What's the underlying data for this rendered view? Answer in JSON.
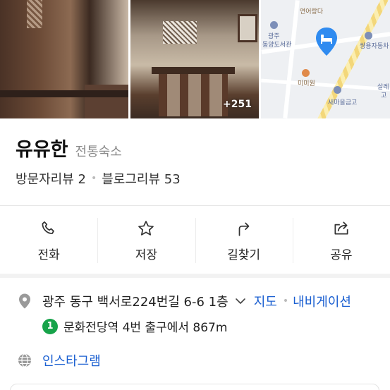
{
  "photos": {
    "more_count": "+251"
  },
  "map": {
    "pois": [
      {
        "label": "연어랑다",
        "type": "food"
      },
      {
        "label": "광주",
        "type": "place"
      },
      {
        "label": "동양도서관",
        "type": "place"
      },
      {
        "label": "쌍용자동차",
        "type": "place"
      },
      {
        "label": "미미원",
        "type": "food"
      },
      {
        "label": "새마을금고",
        "type": "bank"
      },
      {
        "label": "살레",
        "type": "place"
      },
      {
        "label": "고",
        "type": "place"
      }
    ]
  },
  "place": {
    "name": "유유한",
    "category": "전통숙소",
    "visitor_reviews": "방문자리뷰 2",
    "blog_reviews": "블로그리뷰 53"
  },
  "actions": [
    {
      "label": "전화",
      "icon": "phone-icon"
    },
    {
      "label": "저장",
      "icon": "star-icon"
    },
    {
      "label": "길찾기",
      "icon": "directions-icon"
    },
    {
      "label": "공유",
      "icon": "share-icon"
    }
  ],
  "details": {
    "address": "광주 동구 백서로224번길 6-6 1층",
    "map_link": "지도",
    "navigation_link": "내비게이션",
    "subway_line": "1",
    "subway_text": "문화전당역 4번 출구에서 867m",
    "instagram": "인스타그램"
  },
  "colors": {
    "link": "#1a5fd1",
    "subway_line_1": "#17a34a",
    "map_pin": "#2f8bf0"
  }
}
